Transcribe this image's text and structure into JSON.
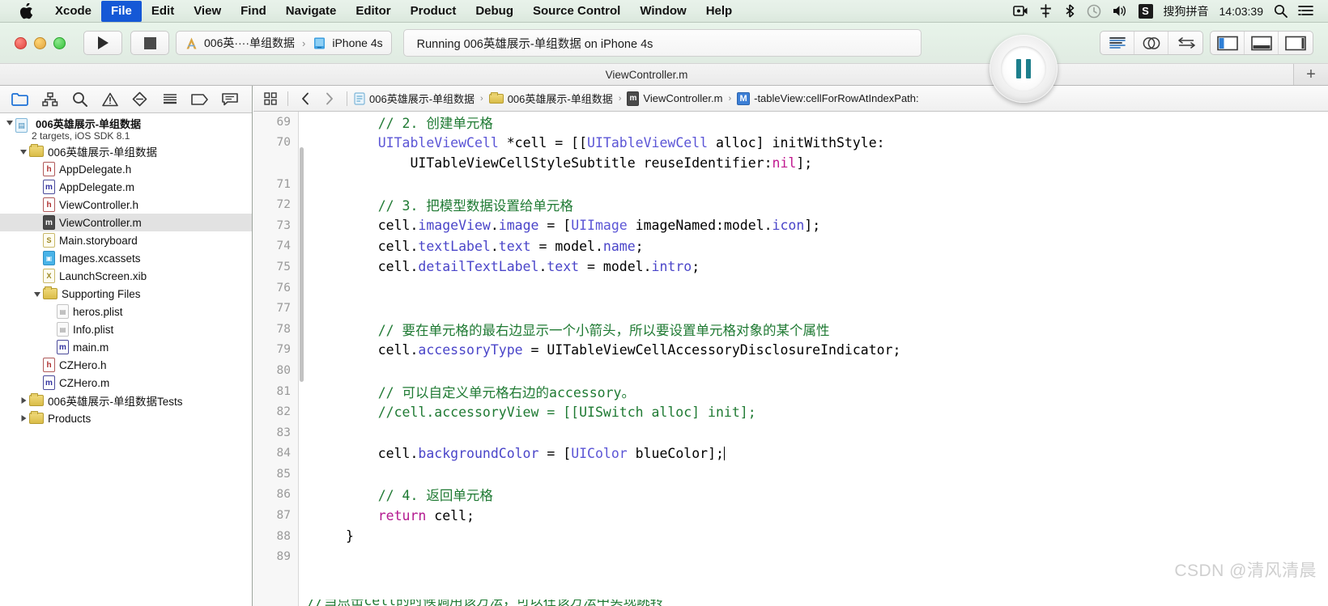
{
  "menubar": {
    "apple_icon": "apple-logo-icon",
    "items": [
      {
        "label": "Xcode",
        "selected": false,
        "bold": true
      },
      {
        "label": "File",
        "selected": true,
        "bold": true
      },
      {
        "label": "Edit",
        "selected": false,
        "bold": true
      },
      {
        "label": "View",
        "selected": false,
        "bold": true
      },
      {
        "label": "Find",
        "selected": false,
        "bold": true
      },
      {
        "label": "Navigate",
        "selected": false,
        "bold": true
      },
      {
        "label": "Editor",
        "selected": false,
        "bold": true
      },
      {
        "label": "Product",
        "selected": false,
        "bold": true
      },
      {
        "label": "Debug",
        "selected": false,
        "bold": true
      },
      {
        "label": "Source Control",
        "selected": false,
        "bold": true
      },
      {
        "label": "Window",
        "selected": false,
        "bold": true
      },
      {
        "label": "Help",
        "selected": false,
        "bold": true
      }
    ],
    "status_icons": [
      "screen-record-icon",
      "airplay-icon",
      "bluetooth-icon",
      "timemachine-icon",
      "volume-icon"
    ],
    "input_method_badge": "S",
    "input_method_label": "搜狗拼音",
    "clock": "14:03:39",
    "right_icons": [
      "search-icon",
      "notification-center-icon"
    ],
    "selected_accent": "#1558d6"
  },
  "toolbar": {
    "run_button": "run-icon",
    "stop_button": "stop-icon",
    "scheme": {
      "scheme_name": "006英····单组数据",
      "separator": "›",
      "destination": "iPhone 4s"
    },
    "activity_status": "Running 006英雄展示-单组数据 on iPhone 4s",
    "pause_button": "pause-icon",
    "editor_segments": [
      "standard-editor-icon",
      "assistant-editor-icon",
      "version-editor-icon"
    ],
    "view_segments": [
      "toggle-navigator-icon",
      "toggle-debug-area-icon",
      "toggle-utilities-icon"
    ]
  },
  "tabbar": {
    "active_tab": "ViewController.m",
    "add_tab": "+"
  },
  "navigator": {
    "toolbar_icons": [
      "project-navigator-icon",
      "symbol-navigator-icon",
      "find-navigator-icon",
      "issue-navigator-icon",
      "test-navigator-icon",
      "debug-navigator-icon",
      "breakpoint-navigator-icon",
      "report-navigator-icon"
    ],
    "active_toolbar_index": 0,
    "tree": [
      {
        "depth": 0,
        "twisty": "down",
        "icon": "project-icon",
        "label": "006英雄展示-单组数据",
        "sublabel": "2 targets, iOS SDK 8.1",
        "selected": false,
        "bold": true
      },
      {
        "depth": 1,
        "twisty": "down",
        "icon": "folder",
        "label": "006英雄展示-单组数据",
        "selected": false
      },
      {
        "depth": 2,
        "twisty": "none",
        "icon": "header",
        "label": "AppDelegate.h",
        "selected": false
      },
      {
        "depth": 2,
        "twisty": "none",
        "icon": "impl",
        "label": "AppDelegate.m",
        "selected": false
      },
      {
        "depth": 2,
        "twisty": "none",
        "icon": "header",
        "label": "ViewController.h",
        "selected": false
      },
      {
        "depth": 2,
        "twisty": "none",
        "icon": "impl-selected",
        "label": "ViewController.m",
        "selected": true
      },
      {
        "depth": 2,
        "twisty": "none",
        "icon": "storyboard",
        "label": "Main.storyboard",
        "selected": false
      },
      {
        "depth": 2,
        "twisty": "none",
        "icon": "xcassets",
        "label": "Images.xcassets",
        "selected": false
      },
      {
        "depth": 2,
        "twisty": "none",
        "icon": "xib",
        "label": "LaunchScreen.xib",
        "selected": false
      },
      {
        "depth": 2,
        "twisty": "down",
        "icon": "folder",
        "label": "Supporting Files",
        "selected": false
      },
      {
        "depth": 3,
        "twisty": "none",
        "icon": "plist",
        "label": "heros.plist",
        "selected": false
      },
      {
        "depth": 3,
        "twisty": "none",
        "icon": "plist",
        "label": "Info.plist",
        "selected": false
      },
      {
        "depth": 3,
        "twisty": "none",
        "icon": "impl",
        "label": "main.m",
        "selected": false
      },
      {
        "depth": 2,
        "twisty": "none",
        "icon": "header",
        "label": "CZHero.h",
        "selected": false
      },
      {
        "depth": 2,
        "twisty": "none",
        "icon": "impl",
        "label": "CZHero.m",
        "selected": false
      },
      {
        "depth": 1,
        "twisty": "right",
        "icon": "folder",
        "label": "006英雄展示-单组数据Tests",
        "selected": false
      },
      {
        "depth": 1,
        "twisty": "right",
        "icon": "folder",
        "label": "Products",
        "selected": false
      }
    ]
  },
  "jumpbar": {
    "related_items_icon": "related-items-icon",
    "back_icon": "chevron-left-icon",
    "forward_icon": "chevron-right-icon",
    "crumbs": [
      {
        "icon": "project-icon",
        "label": "006英雄展示-单组数据"
      },
      {
        "icon": "folder-icon",
        "label": "006英雄展示-单组数据"
      },
      {
        "icon": "impl-file-icon",
        "label": "ViewController.m"
      },
      {
        "icon": "method-icon",
        "label": "-tableView:cellForRowAtIndexPath:"
      }
    ],
    "chevron": "›"
  },
  "editor": {
    "first_line_number": 69,
    "lines": [
      {
        "n": 69,
        "indent": 4,
        "segments": [
          {
            "t": "// 2. 创建单元格",
            "c": "comment"
          }
        ]
      },
      {
        "n": 70,
        "indent": 4,
        "segments": [
          {
            "t": "UITableViewCell",
            "c": "type"
          },
          {
            "t": " *cell = [[",
            "c": "plain"
          },
          {
            "t": "UITableViewCell",
            "c": "type"
          },
          {
            "t": " alloc] initWithStyle:",
            "c": "plain"
          }
        ]
      },
      {
        "n": "",
        "indent": 8,
        "segments": [
          {
            "t": "UITableViewCellStyleSubtitle reuseIdentifier:",
            "c": "plain"
          },
          {
            "t": "nil",
            "c": "lit"
          },
          {
            "t": "];",
            "c": "plain"
          }
        ]
      },
      {
        "n": 71,
        "indent": 4,
        "segments": []
      },
      {
        "n": 72,
        "indent": 4,
        "segments": [
          {
            "t": "// 3. 把模型数据设置给单元格",
            "c": "comment"
          }
        ]
      },
      {
        "n": 73,
        "indent": 4,
        "segments": [
          {
            "t": "cell.",
            "c": "plain"
          },
          {
            "t": "imageView",
            "c": "prop"
          },
          {
            "t": ".",
            "c": "plain"
          },
          {
            "t": "image",
            "c": "prop"
          },
          {
            "t": " = [",
            "c": "plain"
          },
          {
            "t": "UIImage",
            "c": "type"
          },
          {
            "t": " imageNamed:model.",
            "c": "plain"
          },
          {
            "t": "icon",
            "c": "prop"
          },
          {
            "t": "];",
            "c": "plain"
          }
        ]
      },
      {
        "n": 74,
        "indent": 4,
        "segments": [
          {
            "t": "cell.",
            "c": "plain"
          },
          {
            "t": "textLabel",
            "c": "prop"
          },
          {
            "t": ".",
            "c": "plain"
          },
          {
            "t": "text",
            "c": "prop"
          },
          {
            "t": " = model.",
            "c": "plain"
          },
          {
            "t": "name",
            "c": "prop"
          },
          {
            "t": ";",
            "c": "plain"
          }
        ]
      },
      {
        "n": 75,
        "indent": 4,
        "segments": [
          {
            "t": "cell.",
            "c": "plain"
          },
          {
            "t": "detailTextLabel",
            "c": "prop"
          },
          {
            "t": ".",
            "c": "plain"
          },
          {
            "t": "text",
            "c": "prop"
          },
          {
            "t": " = model.",
            "c": "plain"
          },
          {
            "t": "intro",
            "c": "prop"
          },
          {
            "t": ";",
            "c": "plain"
          }
        ]
      },
      {
        "n": 76,
        "indent": 4,
        "segments": []
      },
      {
        "n": 77,
        "indent": 4,
        "segments": []
      },
      {
        "n": 78,
        "indent": 4,
        "segments": [
          {
            "t": "// 要在单元格的最右边显示一个小箭头，所以要设置单元格对象的某个属性",
            "c": "comment"
          }
        ]
      },
      {
        "n": 79,
        "indent": 4,
        "segments": [
          {
            "t": "cell.",
            "c": "plain"
          },
          {
            "t": "accessoryType",
            "c": "prop"
          },
          {
            "t": " = UITableViewCellAccessoryDisclosureIndicator;",
            "c": "plain"
          }
        ]
      },
      {
        "n": 80,
        "indent": 4,
        "segments": []
      },
      {
        "n": 81,
        "indent": 4,
        "segments": [
          {
            "t": "// 可以自定义单元格右边的accessory。",
            "c": "comment"
          }
        ]
      },
      {
        "n": 82,
        "indent": 4,
        "segments": [
          {
            "t": "//cell.accessoryView = [[UISwitch alloc] init];",
            "c": "comment"
          }
        ]
      },
      {
        "n": 83,
        "indent": 4,
        "segments": []
      },
      {
        "n": 84,
        "indent": 4,
        "segments": [
          {
            "t": "cell.",
            "c": "plain"
          },
          {
            "t": "backgroundColor",
            "c": "prop"
          },
          {
            "t": " = [",
            "c": "plain"
          },
          {
            "t": "UIColor",
            "c": "type"
          },
          {
            "t": " blueColor];",
            "c": "plain"
          }
        ],
        "caret": true
      },
      {
        "n": 85,
        "indent": 4,
        "segments": []
      },
      {
        "n": 86,
        "indent": 4,
        "segments": [
          {
            "t": "// 4. 返回单元格",
            "c": "comment"
          }
        ]
      },
      {
        "n": 87,
        "indent": 4,
        "segments": [
          {
            "t": "return",
            "c": "kw"
          },
          {
            "t": " cell;",
            "c": "plain"
          }
        ]
      },
      {
        "n": 88,
        "indent": 0,
        "segments": [
          {
            "t": "}",
            "c": "plain"
          }
        ]
      },
      {
        "n": 89,
        "indent": 0,
        "segments": []
      }
    ]
  },
  "watermark": "CSDN @清风清晨"
}
